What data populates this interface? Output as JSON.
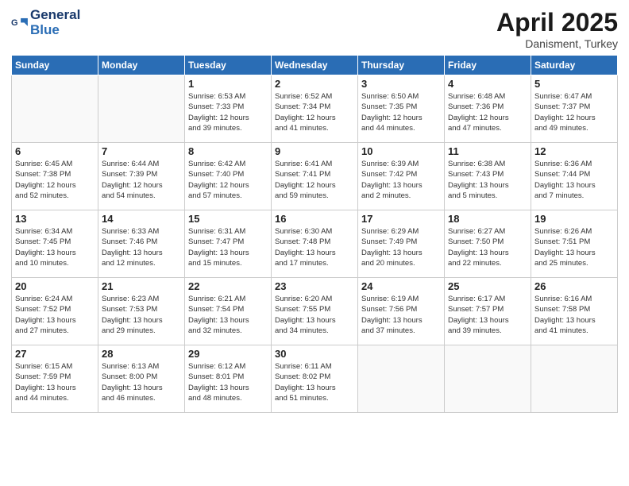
{
  "header": {
    "logo_general": "General",
    "logo_blue": "Blue",
    "month_title": "April 2025",
    "subtitle": "Danisment, Turkey"
  },
  "days_of_week": [
    "Sunday",
    "Monday",
    "Tuesday",
    "Wednesday",
    "Thursday",
    "Friday",
    "Saturday"
  ],
  "weeks": [
    [
      {
        "day": "",
        "info": ""
      },
      {
        "day": "",
        "info": ""
      },
      {
        "day": "1",
        "info": "Sunrise: 6:53 AM\nSunset: 7:33 PM\nDaylight: 12 hours\nand 39 minutes."
      },
      {
        "day": "2",
        "info": "Sunrise: 6:52 AM\nSunset: 7:34 PM\nDaylight: 12 hours\nand 41 minutes."
      },
      {
        "day": "3",
        "info": "Sunrise: 6:50 AM\nSunset: 7:35 PM\nDaylight: 12 hours\nand 44 minutes."
      },
      {
        "day": "4",
        "info": "Sunrise: 6:48 AM\nSunset: 7:36 PM\nDaylight: 12 hours\nand 47 minutes."
      },
      {
        "day": "5",
        "info": "Sunrise: 6:47 AM\nSunset: 7:37 PM\nDaylight: 12 hours\nand 49 minutes."
      }
    ],
    [
      {
        "day": "6",
        "info": "Sunrise: 6:45 AM\nSunset: 7:38 PM\nDaylight: 12 hours\nand 52 minutes."
      },
      {
        "day": "7",
        "info": "Sunrise: 6:44 AM\nSunset: 7:39 PM\nDaylight: 12 hours\nand 54 minutes."
      },
      {
        "day": "8",
        "info": "Sunrise: 6:42 AM\nSunset: 7:40 PM\nDaylight: 12 hours\nand 57 minutes."
      },
      {
        "day": "9",
        "info": "Sunrise: 6:41 AM\nSunset: 7:41 PM\nDaylight: 12 hours\nand 59 minutes."
      },
      {
        "day": "10",
        "info": "Sunrise: 6:39 AM\nSunset: 7:42 PM\nDaylight: 13 hours\nand 2 minutes."
      },
      {
        "day": "11",
        "info": "Sunrise: 6:38 AM\nSunset: 7:43 PM\nDaylight: 13 hours\nand 5 minutes."
      },
      {
        "day": "12",
        "info": "Sunrise: 6:36 AM\nSunset: 7:44 PM\nDaylight: 13 hours\nand 7 minutes."
      }
    ],
    [
      {
        "day": "13",
        "info": "Sunrise: 6:34 AM\nSunset: 7:45 PM\nDaylight: 13 hours\nand 10 minutes."
      },
      {
        "day": "14",
        "info": "Sunrise: 6:33 AM\nSunset: 7:46 PM\nDaylight: 13 hours\nand 12 minutes."
      },
      {
        "day": "15",
        "info": "Sunrise: 6:31 AM\nSunset: 7:47 PM\nDaylight: 13 hours\nand 15 minutes."
      },
      {
        "day": "16",
        "info": "Sunrise: 6:30 AM\nSunset: 7:48 PM\nDaylight: 13 hours\nand 17 minutes."
      },
      {
        "day": "17",
        "info": "Sunrise: 6:29 AM\nSunset: 7:49 PM\nDaylight: 13 hours\nand 20 minutes."
      },
      {
        "day": "18",
        "info": "Sunrise: 6:27 AM\nSunset: 7:50 PM\nDaylight: 13 hours\nand 22 minutes."
      },
      {
        "day": "19",
        "info": "Sunrise: 6:26 AM\nSunset: 7:51 PM\nDaylight: 13 hours\nand 25 minutes."
      }
    ],
    [
      {
        "day": "20",
        "info": "Sunrise: 6:24 AM\nSunset: 7:52 PM\nDaylight: 13 hours\nand 27 minutes."
      },
      {
        "day": "21",
        "info": "Sunrise: 6:23 AM\nSunset: 7:53 PM\nDaylight: 13 hours\nand 29 minutes."
      },
      {
        "day": "22",
        "info": "Sunrise: 6:21 AM\nSunset: 7:54 PM\nDaylight: 13 hours\nand 32 minutes."
      },
      {
        "day": "23",
        "info": "Sunrise: 6:20 AM\nSunset: 7:55 PM\nDaylight: 13 hours\nand 34 minutes."
      },
      {
        "day": "24",
        "info": "Sunrise: 6:19 AM\nSunset: 7:56 PM\nDaylight: 13 hours\nand 37 minutes."
      },
      {
        "day": "25",
        "info": "Sunrise: 6:17 AM\nSunset: 7:57 PM\nDaylight: 13 hours\nand 39 minutes."
      },
      {
        "day": "26",
        "info": "Sunrise: 6:16 AM\nSunset: 7:58 PM\nDaylight: 13 hours\nand 41 minutes."
      }
    ],
    [
      {
        "day": "27",
        "info": "Sunrise: 6:15 AM\nSunset: 7:59 PM\nDaylight: 13 hours\nand 44 minutes."
      },
      {
        "day": "28",
        "info": "Sunrise: 6:13 AM\nSunset: 8:00 PM\nDaylight: 13 hours\nand 46 minutes."
      },
      {
        "day": "29",
        "info": "Sunrise: 6:12 AM\nSunset: 8:01 PM\nDaylight: 13 hours\nand 48 minutes."
      },
      {
        "day": "30",
        "info": "Sunrise: 6:11 AM\nSunset: 8:02 PM\nDaylight: 13 hours\nand 51 minutes."
      },
      {
        "day": "",
        "info": ""
      },
      {
        "day": "",
        "info": ""
      },
      {
        "day": "",
        "info": ""
      }
    ]
  ]
}
